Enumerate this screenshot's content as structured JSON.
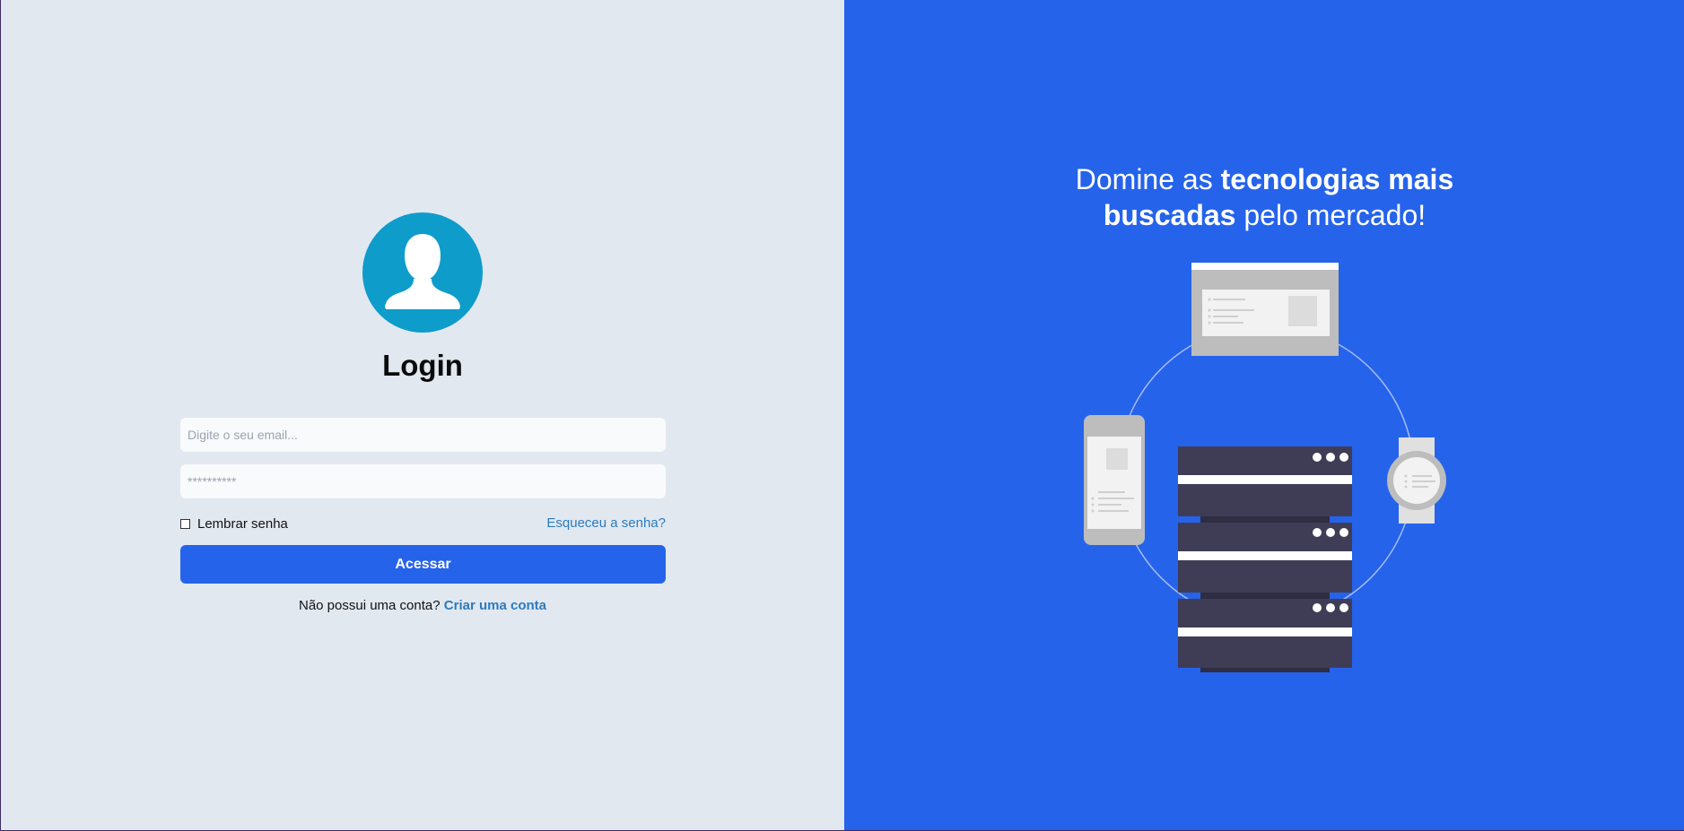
{
  "login": {
    "title": "Login",
    "email_placeholder": "Digite o seu email...",
    "password_placeholder": "**********",
    "remember_label": "Lembrar senha",
    "forgot_label": "Esqueceu a senha?",
    "submit_label": "Acessar",
    "signup_prompt": "Não possui uma conta?",
    "signup_link": "Criar uma conta"
  },
  "promo": {
    "headline_part1": "Domine as ",
    "headline_bold1": "tecnologias mais",
    "headline_bold2": "buscadas",
    "headline_part2": " pelo mercado!"
  },
  "icons": {
    "avatar": "user-silhouette-icon",
    "illustration": "devices-server-illustration"
  },
  "colors": {
    "left_background": "#e2e8f0",
    "right_background": "#2563eb",
    "avatar": "#0e9ccb",
    "button": "#2563eb",
    "link": "#2b7bbf",
    "server": "#3f3d56"
  }
}
